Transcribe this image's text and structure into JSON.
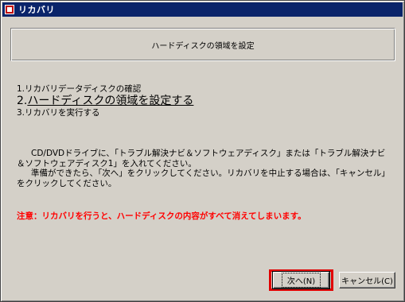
{
  "window": {
    "title": "リカバリ"
  },
  "header": {
    "title": "ハードディスクの領域を設定"
  },
  "steps": [
    {
      "number": "1.",
      "label": "リカバリデータディスクの確認"
    },
    {
      "number": "2.",
      "label": "ハードディスクの領域を設定する"
    },
    {
      "number": "3.",
      "label": "リカバリを実行する"
    }
  ],
  "instructions": {
    "paragraph1": "CD/DVDドライブに、「トラブル解決ナビ＆ソフトウェアディスク」または「トラブル解決ナビ＆ソフトウェアディスク1」を入れてください。",
    "paragraph2": "準備ができたら、「次へ」をクリックしてください。リカバリを中止する場合は、「キャンセル」をクリックしてください。"
  },
  "warning": "注意：リカバリを行うと、ハードディスクの内容がすべて消えてしまいます。",
  "buttons": {
    "next": "次へ(N)",
    "cancel": "キャンセル(C)"
  },
  "colors": {
    "titlebar": "#0a246a",
    "warning": "#ff0000",
    "highlight": "#e00000",
    "face": "#d4d0c8"
  }
}
